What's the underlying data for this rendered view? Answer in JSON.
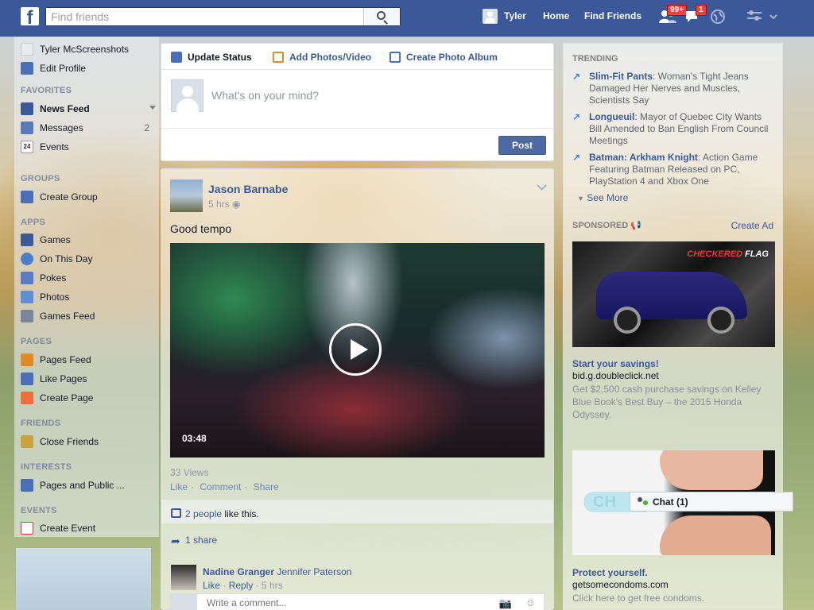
{
  "topbar": {
    "logo": "f",
    "search_placeholder": "Find friends",
    "user_name": "Tyler",
    "home": "Home",
    "find_friends": "Find Friends",
    "friend_requests_badge": "99+",
    "messages_badge": "1"
  },
  "sidebar": {
    "profile_name": "Tyler McScreenshots",
    "edit_profile": "Edit Profile",
    "favorites_head": "FAVORITES",
    "news_feed": "News Feed",
    "messages": "Messages",
    "messages_count": "2",
    "events": "Events",
    "events_icon": "24",
    "groups_head": "GROUPS",
    "create_group": "Create Group",
    "apps_head": "APPS",
    "games": "Games",
    "on_this_day": "On This Day",
    "pokes": "Pokes",
    "photos": "Photos",
    "games_feed": "Games Feed",
    "pages_head": "PAGES",
    "pages_feed": "Pages Feed",
    "like_pages": "Like Pages",
    "create_page": "Create Page",
    "friends_head": "FRIENDS",
    "close_friends": "Close Friends",
    "interests_head": "INTERESTS",
    "pages_public": "Pages and Public ...",
    "events_head": "EVENTS",
    "create_event": "Create Event"
  },
  "composer": {
    "tab_status": "Update Status",
    "tab_photos": "Add Photos/Video",
    "tab_album": "Create Photo Album",
    "placeholder": "What's on your mind?",
    "post_button": "Post"
  },
  "story": {
    "author": "Jason Barnabe",
    "time": "5 hrs",
    "text": "Good tempo",
    "video_time": "03:48",
    "views": "33 Views",
    "like": "Like",
    "comment": "Comment",
    "share": "Share",
    "likes_link": "2 people",
    "likes_rest": " like this.",
    "shares": "1 share",
    "comment_author": "Nadine Granger",
    "comment_tag": "Jennifer Paterson",
    "comment_like": "Like",
    "comment_reply": "Reply",
    "comment_time": "5 hrs",
    "write_placeholder": "Write a comment..."
  },
  "trending": {
    "head": "TRENDING",
    "items": [
      {
        "name": "Slim-Fit Pants",
        "desc": ": Woman's Tight Jeans Damaged Her Nerves and Muscles, Scientists Say"
      },
      {
        "name": "Longueuil",
        "desc": ": Mayor of Quebec City Wants Bill Amended to Ban English From Council Meetings"
      },
      {
        "name": "Batman: Arkham Knight",
        "desc": ": Action Game Featuring Batman Released on PC, PlayStation 4 and Xbox One"
      }
    ],
    "see_more": "See More"
  },
  "sponsored": {
    "head": "SPONSORED",
    "create_ad": "Create Ad",
    "ad1_flag_a": "CHECKERED",
    "ad1_flag_b": "FLAG",
    "ad1_title": "Start your savings!",
    "ad1_url": "bid.g.doubleclick.net",
    "ad1_desc": "Get $2,500 cash purchase savings on Kelley Blue Book's Best Buy – the 2015 Honda Odyssey.",
    "ad2_logo": "CH",
    "ad2_title": "Protect yourself.",
    "ad2_url": "getsomecondoms.com",
    "ad2_desc": "Click here to get free condoms."
  },
  "chat": {
    "label": "Chat (1)"
  }
}
